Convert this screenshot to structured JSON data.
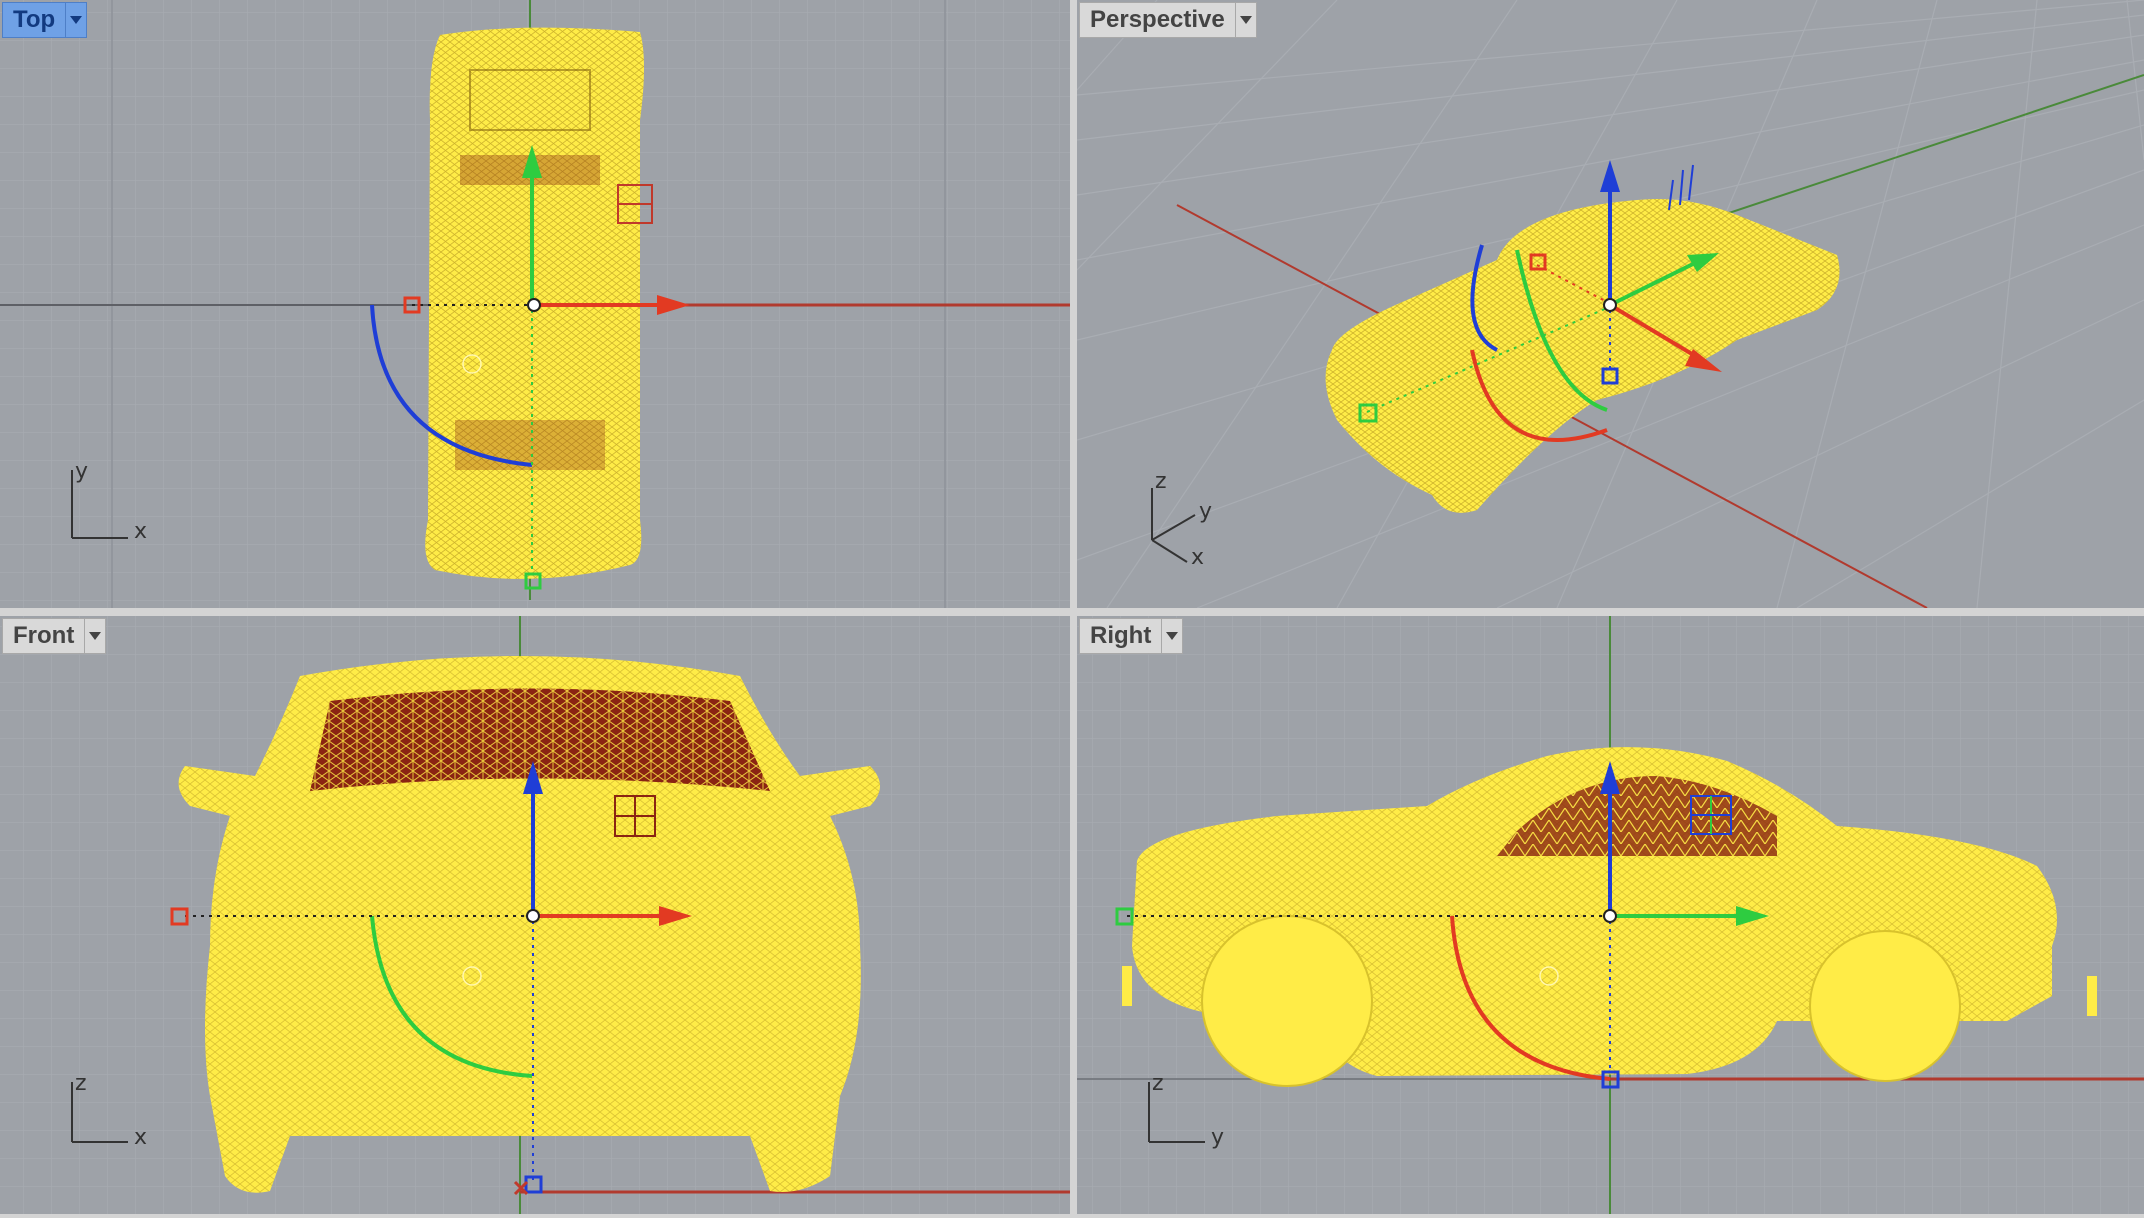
{
  "viewports": {
    "top": {
      "label": "Top",
      "active": true,
      "axes": [
        "y",
        "x"
      ]
    },
    "perspective": {
      "label": "Perspective",
      "active": false,
      "axes": [
        "z",
        "y",
        "x"
      ]
    },
    "front": {
      "label": "Front",
      "active": false,
      "axes": [
        "z",
        "x"
      ]
    },
    "right": {
      "label": "Right",
      "active": false,
      "axes": [
        "z",
        "y"
      ]
    }
  },
  "colors": {
    "viewport_bg": "#9ea2a8",
    "grid_minor": "#a7abb1",
    "grid_major": "#8e9299",
    "model_fill": "#ffec47",
    "mesh_dark": "#8a2412",
    "x_axis": "#c0392b",
    "y_axis": "#2ecc40",
    "z_axis": "#1f3ed6",
    "active_tab": "#6fa1e6"
  },
  "icons": {
    "dropdown": "chevron-down-icon",
    "gumball": "gumball-manipulator-icon",
    "axis_triad": "axis-triad-icon"
  }
}
